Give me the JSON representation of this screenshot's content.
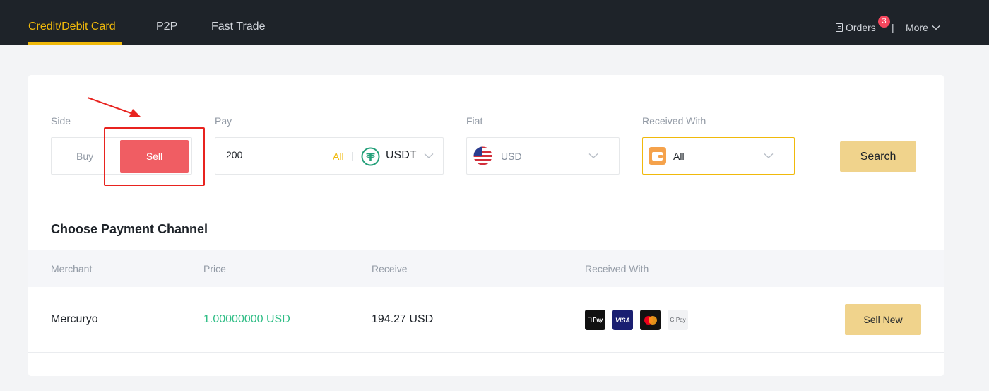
{
  "nav": {
    "tabs": [
      {
        "label": "Credit/Debit Card",
        "active": true
      },
      {
        "label": "P2P",
        "active": false
      },
      {
        "label": "Fast Trade",
        "active": false
      }
    ],
    "orders_label": "Orders",
    "orders_badge": "3",
    "divider": "|",
    "more_label": "More"
  },
  "form": {
    "side": {
      "label": "Side",
      "buy": "Buy",
      "sell": "Sell",
      "selected": "Sell"
    },
    "pay": {
      "label": "Pay",
      "amount": "200",
      "all": "All",
      "sep": "|",
      "currency": "USDT",
      "currency_icon": "tether-icon"
    },
    "fiat": {
      "label": "Fiat",
      "currency": "USD",
      "icon": "us-flag-icon"
    },
    "received_with": {
      "label": "Received With",
      "value": "All",
      "icon": "wallet-icon"
    },
    "search_label": "Search"
  },
  "channels": {
    "title": "Choose Payment Channel",
    "columns": [
      "Merchant",
      "Price",
      "Receive",
      "Received With"
    ],
    "rows": [
      {
        "merchant": "Mercuryo",
        "price": "1.00000000 USD",
        "receive": "194.27 USD",
        "methods": [
          "apple-pay-icon",
          "visa-icon",
          "mastercard-icon",
          "google-pay-icon"
        ],
        "method_labels": {
          "apple": "Pay",
          "visa": "VISA",
          "gpay": "G Pay"
        },
        "action": "Sell New"
      }
    ]
  },
  "colors": {
    "topbar": "#1e2329",
    "accent": "#f0b90b",
    "sell": "#f05d63",
    "price": "#2ebd85",
    "highlight": "#e8231f"
  }
}
